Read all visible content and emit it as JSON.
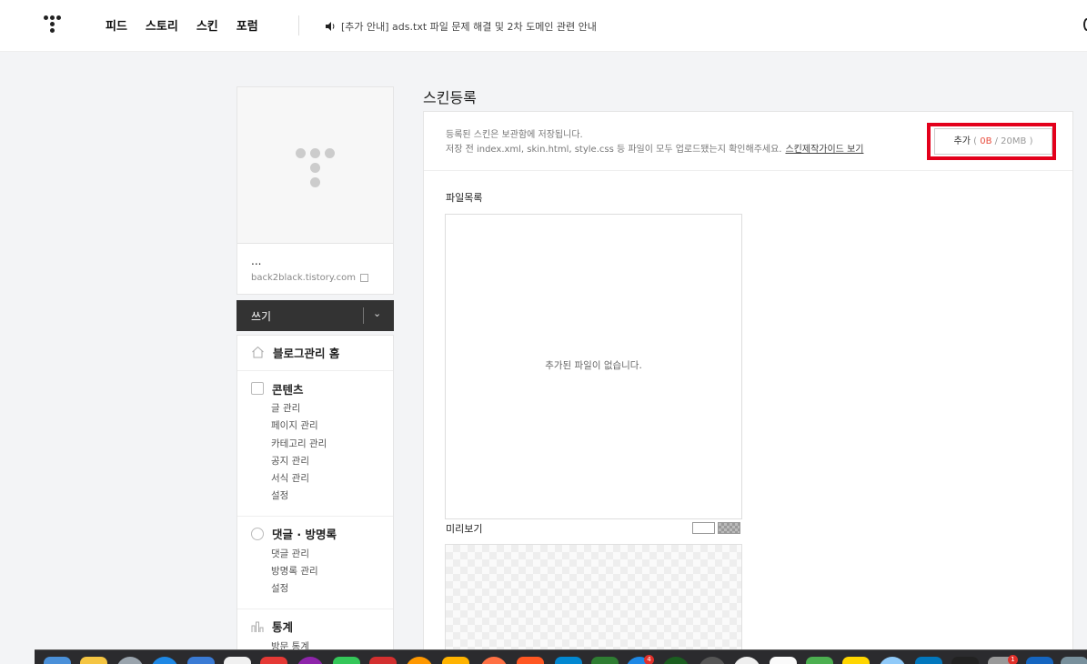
{
  "topbar": {
    "nav": [
      "피드",
      "스토리",
      "스킨",
      "포럼"
    ],
    "notice": "[추가 안내] ads.txt 파일 문제 해결 및 2차 도메인 관련 안내"
  },
  "sidebar": {
    "blog_name": "...",
    "blog_url": "back2black.tistory.com",
    "write_label": "쓰기",
    "home_label": "블로그관리 홈",
    "sections": [
      {
        "title": "콘텐츠",
        "icon": "document-icon",
        "items": [
          "글 관리",
          "페이지 관리",
          "카테고리 관리",
          "공지 관리",
          "서식 관리",
          "설정"
        ]
      },
      {
        "title": "댓글 · 방명록",
        "icon": "comment-icon",
        "items": [
          "댓글 관리",
          "방명록 관리",
          "설정"
        ]
      },
      {
        "title": "통계",
        "icon": "chart-icon",
        "items": [
          "방문 통계"
        ]
      }
    ]
  },
  "main": {
    "title": "스킨등록",
    "desc_line1": "등록된 스킨은 보관함에 저장됩니다.",
    "desc_line2": "저장 전 index.xml, skin.html, style.css 등 파일이 모두 업로드됐는지 확인해주세요.",
    "guide_link": "스킨제작가이드 보기",
    "add_button": {
      "label": "추가",
      "used": "0B",
      "limit": "20MB"
    },
    "files_label": "파일목록",
    "empty_message": "추가된 파일이 없습니다.",
    "preview_label": "미리보기"
  },
  "colors": {
    "highlight": "#e3001b",
    "usage": "#e84c3d",
    "write_bg": "#333333"
  },
  "dock": {
    "badges": [
      "4",
      "1"
    ]
  }
}
